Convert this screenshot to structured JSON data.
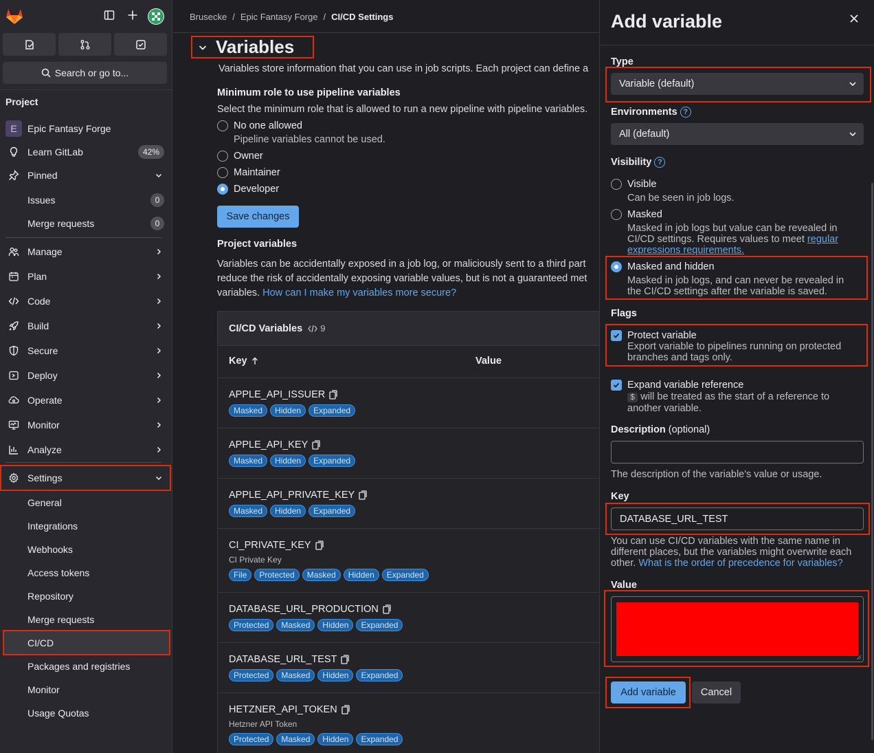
{
  "sidebar": {
    "search_label": "Search or go to...",
    "section_heading": "Project",
    "project_name": "Epic Fantasy Forge",
    "project_initial": "E",
    "learn_label": "Learn GitLab",
    "learn_progress": "42%",
    "pinned_label": "Pinned",
    "pinned": [
      {
        "label": "Issues",
        "count": "0"
      },
      {
        "label": "Merge requests",
        "count": "0"
      }
    ],
    "groups": [
      {
        "label": "Manage",
        "icon": "users-icon"
      },
      {
        "label": "Plan",
        "icon": "calendar-icon"
      },
      {
        "label": "Code",
        "icon": "code-icon"
      },
      {
        "label": "Build",
        "icon": "rocket-icon"
      },
      {
        "label": "Secure",
        "icon": "shield-icon"
      },
      {
        "label": "Deploy",
        "icon": "deploy-icon"
      },
      {
        "label": "Operate",
        "icon": "cloud-gear-icon"
      },
      {
        "label": "Monitor",
        "icon": "monitor-icon"
      },
      {
        "label": "Analyze",
        "icon": "chart-icon"
      }
    ],
    "settings_label": "Settings",
    "settings_items": [
      {
        "label": "General"
      },
      {
        "label": "Integrations"
      },
      {
        "label": "Webhooks"
      },
      {
        "label": "Access tokens"
      },
      {
        "label": "Repository"
      },
      {
        "label": "Merge requests"
      },
      {
        "label": "CI/CD"
      },
      {
        "label": "Packages and registries"
      },
      {
        "label": "Monitor"
      },
      {
        "label": "Usage Quotas"
      }
    ]
  },
  "breadcrumb": {
    "items": [
      "Brusecke",
      "Epic Fantasy Forge",
      "CI/CD Settings"
    ],
    "separator": "/"
  },
  "main": {
    "section_title": "Variables",
    "section_desc": "Variables store information that you can use in job scripts. Each project can define a",
    "min_role_heading": "Minimum role to use pipeline variables",
    "min_role_desc": "Select the minimum role that is allowed to run a new pipeline with pipeline variables.",
    "roles": [
      {
        "label": "No one allowed",
        "help": "Pipeline variables cannot be used.",
        "selected": false
      },
      {
        "label": "Owner",
        "help": "",
        "selected": false
      },
      {
        "label": "Maintainer",
        "help": "",
        "selected": false
      },
      {
        "label": "Developer",
        "help": "",
        "selected": true
      }
    ],
    "save_label": "Save changes",
    "project_vars_heading": "Project variables",
    "project_vars_desc_1": "Variables can be accidentally exposed in a job log, or maliciously sent to a third part",
    "project_vars_desc_2": "reduce the risk of accidentally exposing variable values, but is not a guaranteed met",
    "project_vars_desc_3": "variables.",
    "secure_link": "How can I make my variables more secure?",
    "card_title": "CI/CD Variables",
    "card_count": "9",
    "col_key": "Key",
    "col_value": "Value",
    "variables": [
      {
        "key": "APPLE_API_ISSUER",
        "desc": "",
        "badges": [
          "Masked",
          "Hidden",
          "Expanded"
        ]
      },
      {
        "key": "APPLE_API_KEY",
        "desc": "",
        "badges": [
          "Masked",
          "Hidden",
          "Expanded"
        ]
      },
      {
        "key": "APPLE_API_PRIVATE_KEY",
        "desc": "",
        "badges": [
          "Masked",
          "Hidden",
          "Expanded"
        ]
      },
      {
        "key": "CI_PRIVATE_KEY",
        "desc": "CI Private Key",
        "badges": [
          "File",
          "Protected",
          "Masked",
          "Hidden",
          "Expanded"
        ]
      },
      {
        "key": "DATABASE_URL_PRODUCTION",
        "desc": "",
        "badges": [
          "Protected",
          "Masked",
          "Hidden",
          "Expanded"
        ]
      },
      {
        "key": "DATABASE_URL_TEST",
        "desc": "",
        "badges": [
          "Protected",
          "Masked",
          "Hidden",
          "Expanded"
        ]
      },
      {
        "key": "HETZNER_API_TOKEN",
        "desc": "Hetzner API Token",
        "badges": [
          "Protected",
          "Masked",
          "Hidden",
          "Expanded"
        ]
      }
    ]
  },
  "drawer": {
    "title": "Add variable",
    "type_label": "Type",
    "type_value": "Variable (default)",
    "env_label": "Environments",
    "env_value": "All (default)",
    "visibility_label": "Visibility",
    "vis_visible": "Visible",
    "vis_visible_help": "Can be seen in job logs.",
    "vis_masked": "Masked",
    "vis_masked_help": "Masked in job logs but value can be revealed in CI/CD settings. Requires values to meet",
    "vis_masked_link": "regular expressions requirements.",
    "vis_hidden": "Masked and hidden",
    "vis_hidden_help": "Masked in job logs, and can never be revealed in the CI/CD settings after the variable is saved.",
    "flags_label": "Flags",
    "protect_label": "Protect variable",
    "protect_help": "Export variable to pipelines running on protected branches and tags only.",
    "expand_label": "Expand variable reference",
    "expand_code": "$",
    "expand_help": "will be treated as the start of a reference to another variable.",
    "desc_label": "Description",
    "desc_optional": "(optional)",
    "desc_value": "",
    "desc_help": "The description of the variable's value or usage.",
    "key_label": "Key",
    "key_value": "DATABASE_URL_TEST",
    "key_help": "You can use CI/CD variables with the same name in different places, but the variables might overwrite each other.",
    "key_help_link": "What is the order of precedence for variables?",
    "value_label": "Value",
    "add_label": "Add variable",
    "cancel_label": "Cancel"
  },
  "colors": {
    "accent": "#63a6e9",
    "highlight": "#dd2b0e",
    "redacted": "#ff0000"
  }
}
